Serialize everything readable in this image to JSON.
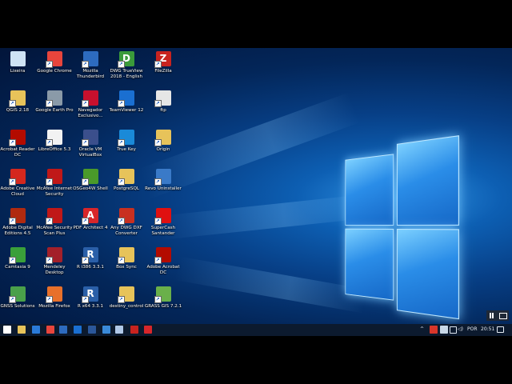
{
  "desktop": {
    "icons": [
      {
        "label": "Lixeira",
        "icon": "recycle-bin-icon",
        "color": "#cfe3f5"
      },
      {
        "label": "Google Chrome",
        "icon": "chrome-icon",
        "color": "#e8453c"
      },
      {
        "label": "Mozilla\nThunderbird",
        "icon": "thunderbird-icon",
        "color": "#2d6bbf"
      },
      {
        "label": "DWG TrueView\n2018 - English",
        "icon": "dwg-trueview-icon",
        "color": "#3a9a3a",
        "glyph": "D"
      },
      {
        "label": "FileZilla",
        "icon": "filezilla-icon",
        "color": "#c8231f",
        "glyph": "Z"
      },
      {
        "label": "QGIS 2.18",
        "icon": "folder-icon",
        "color": "#e7c35a"
      },
      {
        "label": "Google Earth Pro",
        "icon": "google-earth-icon",
        "color": "#8a9aa8"
      },
      {
        "label": "Navegador\nExclusivo...",
        "icon": "navegador-icon",
        "color": "#c8102e"
      },
      {
        "label": "TeamViewer 12",
        "icon": "teamviewer-icon",
        "color": "#1a6fd1"
      },
      {
        "label": "ftp",
        "icon": "file-icon",
        "color": "#e6e6e6"
      },
      {
        "label": "Acrobat Reader\nDC",
        "icon": "acrobat-reader-icon",
        "color": "#b30b00"
      },
      {
        "label": "LibreOffice 5.3",
        "icon": "libreoffice-icon",
        "color": "#f2f2f2"
      },
      {
        "label": "Oracle VM\nVirtualBox",
        "icon": "virtualbox-icon",
        "color": "#3b4f8c"
      },
      {
        "label": "True Key",
        "icon": "true-key-icon",
        "color": "#1a8ad8"
      },
      {
        "label": "Origin",
        "icon": "folder-icon",
        "color": "#e7c35a"
      },
      {
        "label": "Adobe Creative\nCloud",
        "icon": "creative-cloud-icon",
        "color": "#d4281e"
      },
      {
        "label": "McAfee Internet\nSecurity",
        "icon": "mcafee-icon",
        "color": "#c01818"
      },
      {
        "label": "OSGeo4W Shell",
        "icon": "osgeo-icon",
        "color": "#4a9a2a"
      },
      {
        "label": "PostgreSQL",
        "icon": "folder-icon",
        "color": "#e7c35a"
      },
      {
        "label": "Revo Uninstaller",
        "icon": "revo-uninstaller-icon",
        "color": "#3a7ac8"
      },
      {
        "label": "Adobe Digital\nEditions 4.5",
        "icon": "digital-editions-icon",
        "color": "#b02a10"
      },
      {
        "label": "McAfee Security\nScan Plus",
        "icon": "mcafee-icon",
        "color": "#c01818"
      },
      {
        "label": "PDF Architect 4",
        "icon": "pdf-architect-icon",
        "color": "#d8262a",
        "glyph": "A"
      },
      {
        "label": "Any DWG DXF\nConverter",
        "icon": "dwg-converter-icon",
        "color": "#c83020"
      },
      {
        "label": "SuperCash\nSantander",
        "icon": "santander-icon",
        "color": "#e01010"
      },
      {
        "label": "Camtasia 9",
        "icon": "camtasia-icon",
        "color": "#3aa03a"
      },
      {
        "label": "Mendeley\nDesktop",
        "icon": "mendeley-icon",
        "color": "#a3202a"
      },
      {
        "label": "R i386 3.3.1",
        "icon": "r-icon",
        "color": "#2a5fa8",
        "glyph": "R"
      },
      {
        "label": "Box Sync",
        "icon": "box-sync-icon",
        "color": "#e7c35a"
      },
      {
        "label": "Adobe Acrobat\nDC",
        "icon": "acrobat-dc-icon",
        "color": "#b30b00"
      },
      {
        "label": "GNSS Solutions",
        "icon": "gnss-icon",
        "color": "#4aa04a"
      },
      {
        "label": "Mozilla Firefox",
        "icon": "firefox-icon",
        "color": "#e8702a"
      },
      {
        "label": "R x64 3.3.1",
        "icon": "r-icon",
        "color": "#2a5fa8",
        "glyph": "R"
      },
      {
        "label": "destiny_control",
        "icon": "folder-icon",
        "color": "#e7c35a"
      },
      {
        "label": "GRASS GIS 7.2.1",
        "icon": "grass-gis-icon",
        "color": "#6ab04a"
      }
    ]
  },
  "taskbar": {
    "pinned": [
      {
        "icon": "start-icon",
        "color": "#ffffff"
      },
      {
        "icon": "file-explorer-icon",
        "color": "#e7c35a"
      },
      {
        "icon": "store-icon",
        "color": "#2a7ad8"
      },
      {
        "icon": "chrome-icon",
        "color": "#e8453c"
      },
      {
        "icon": "thunderbird-icon",
        "color": "#2d6bbf"
      },
      {
        "icon": "settings-icon",
        "color": "#1a6fd1"
      },
      {
        "icon": "word-icon",
        "color": "#2b579a"
      },
      {
        "icon": "app-icon",
        "color": "#3a8ad8"
      },
      {
        "icon": "app-icon",
        "color": "#b0c8e8"
      },
      {
        "icon": "filezilla-icon",
        "color": "#c8231f"
      },
      {
        "icon": "pdf-architect-icon",
        "color": "#d8262a"
      }
    ],
    "tray": {
      "language": "POR",
      "time": "20:51"
    }
  }
}
